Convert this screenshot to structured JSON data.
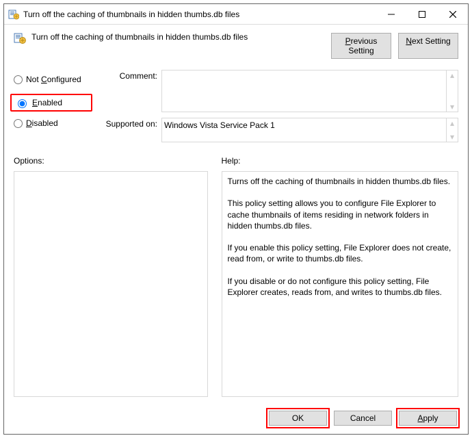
{
  "window": {
    "title": "Turn off the caching of thumbnails in hidden thumbs.db files"
  },
  "header": {
    "policy_name": "Turn off the caching of thumbnails in hidden thumbs.db files",
    "previous_label": "Previous Setting",
    "next_label": "Next Setting"
  },
  "radios": {
    "not_configured": "Not Configured",
    "enabled": "Enabled",
    "disabled": "Disabled"
  },
  "fields": {
    "comment_label": "Comment:",
    "comment_value": "",
    "supported_label": "Supported on:",
    "supported_value": "Windows Vista Service Pack 1"
  },
  "sections": {
    "options_label": "Options:",
    "help_label": "Help:",
    "help_text_1": "Turns off the caching of thumbnails in hidden thumbs.db files.",
    "help_text_2": "This policy setting allows you to configure File Explorer to cache thumbnails of items residing in network folders in hidden thumbs.db files.",
    "help_text_3": "If you enable this policy setting, File Explorer does not create, read from, or write to thumbs.db files.",
    "help_text_4": "If you disable or do not configure this policy setting, File Explorer creates, reads from, and writes to thumbs.db files."
  },
  "footer": {
    "ok": "OK",
    "cancel": "Cancel",
    "apply": "Apply"
  }
}
